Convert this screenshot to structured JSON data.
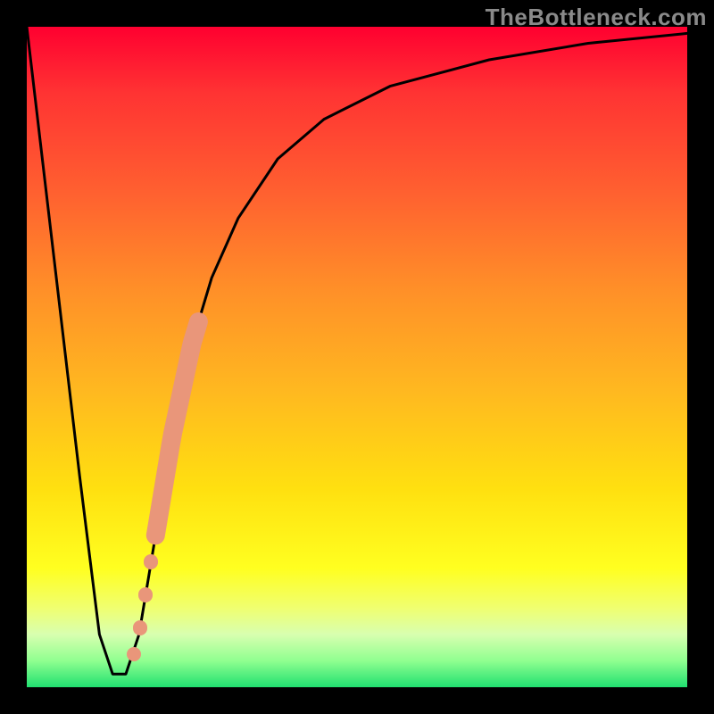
{
  "watermark": "TheBottleneck.com",
  "chart_data": {
    "type": "line",
    "title": "",
    "xlabel": "",
    "ylabel": "",
    "xlim": [
      0,
      100
    ],
    "ylim": [
      0,
      100
    ],
    "grid": false,
    "legend": false,
    "series": [
      {
        "name": "bottleneck-curve",
        "x": [
          0,
          4,
          8,
          11,
          13,
          15,
          17,
          19,
          22,
          25,
          28,
          32,
          38,
          45,
          55,
          70,
          85,
          100
        ],
        "values": [
          100,
          66,
          32,
          8,
          2,
          2,
          8,
          20,
          38,
          52,
          62,
          71,
          80,
          86,
          91,
          95,
          97.5,
          99
        ]
      }
    ],
    "markers": [
      {
        "name": "thick-segment",
        "xrange": [
          19.5,
          26
        ],
        "yrange": [
          24,
          57
        ],
        "radius_pct": 1.5
      },
      {
        "name": "dot-1",
        "x": 18.8,
        "y": 19,
        "radius_pct": 1.1
      },
      {
        "name": "dot-2",
        "x": 18.0,
        "y": 14,
        "radius_pct": 1.1
      },
      {
        "name": "dot-3",
        "x": 17.2,
        "y": 9,
        "radius_pct": 1.1
      },
      {
        "name": "dot-4",
        "x": 16.2,
        "y": 5,
        "radius_pct": 1.1
      }
    ],
    "colors": {
      "curve": "#000000",
      "markers": "#E9967A",
      "gradient_top": "#FF0030",
      "gradient_mid": "#FFE010",
      "gradient_bottom": "#20E070",
      "frame": "#000000"
    }
  }
}
